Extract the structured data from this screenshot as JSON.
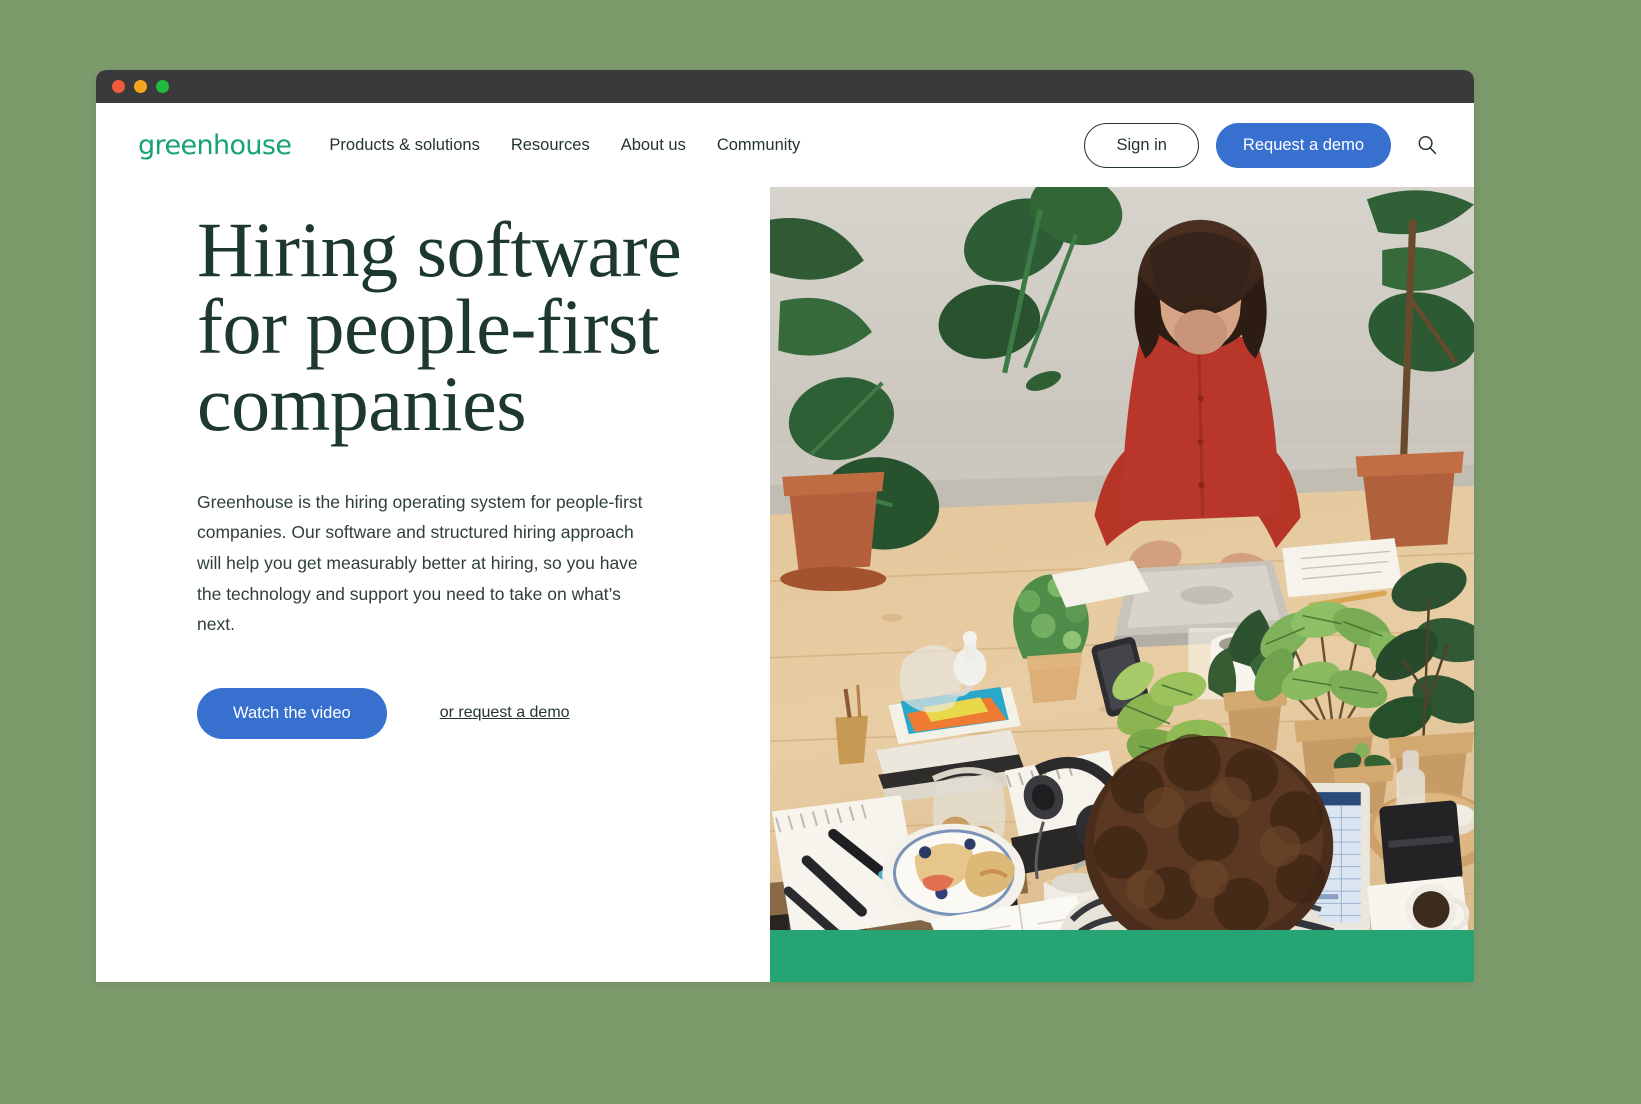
{
  "window": {
    "traffic_lights": [
      "close",
      "minimize",
      "maximize"
    ],
    "chrome_color": "#3a3a3c",
    "page_background": "#7d9c6c"
  },
  "nav": {
    "logo": "greenhouse",
    "logo_color": "#17A277",
    "links": [
      {
        "label": "Products & solutions"
      },
      {
        "label": "Resources"
      },
      {
        "label": "About us"
      },
      {
        "label": "Community"
      }
    ],
    "sign_in_label": "Sign in",
    "request_demo_label": "Request a demo",
    "request_demo_color": "#3770cf",
    "search_icon": "search-icon"
  },
  "hero": {
    "title": "Hiring software for people-first companies",
    "description": "Greenhouse is the hiring operating system for people-first companies. Our software and structured hiring approach will help you get measurably better at hiring, so you have the technology and support you need to take on what’s next.",
    "title_color": "#1d382e",
    "primary_cta": "Watch the video",
    "secondary_cta": "or request a demo",
    "accent_band_color": "#27a474",
    "image_alt": "Overhead view of two people working at a light wood table covered with potted plants, laptops, headphones, notebooks and coffee"
  }
}
